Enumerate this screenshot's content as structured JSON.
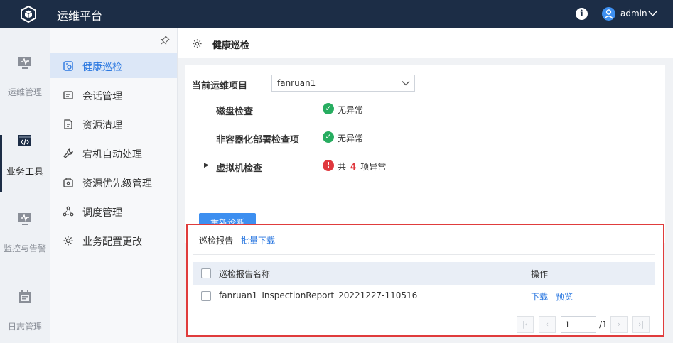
{
  "header": {
    "app_title": "运维平台",
    "user_name": "admin"
  },
  "rail": [
    {
      "label": "运维管理",
      "icon": "monitor-pulse-icon"
    },
    {
      "label": "业务工具",
      "icon": "code-window-icon",
      "active": true
    },
    {
      "label": "监控与告警",
      "icon": "monitor-pulse-icon"
    },
    {
      "label": "日志管理",
      "icon": "calendar-icon"
    }
  ],
  "subnav": [
    {
      "label": "健康巡检",
      "icon": "health-check-icon",
      "active": true
    },
    {
      "label": "会话管理",
      "icon": "session-icon"
    },
    {
      "label": "资源清理",
      "icon": "cleanup-icon"
    },
    {
      "label": "宕机自动处理",
      "icon": "wrench-icon"
    },
    {
      "label": "资源优先级管理",
      "icon": "priority-icon"
    },
    {
      "label": "调度管理",
      "icon": "schedule-icon"
    },
    {
      "label": "业务配置更改",
      "icon": "config-gear-icon"
    }
  ],
  "page": {
    "title": "健康巡检"
  },
  "diagnosis": {
    "project_label": "当前运维项目",
    "project_value": "fanruan1",
    "checks": [
      {
        "name": "磁盘检查",
        "status": "无异常"
      },
      {
        "name": "非容器化部署检查项",
        "status": "无异常"
      },
      {
        "name": "虚拟机检查",
        "status_prefix": "共",
        "status_count": "4",
        "status_suffix": "项异常"
      }
    ],
    "rediagnose_label": "重新诊断"
  },
  "report": {
    "title": "巡检报告",
    "batch_download": "批量下载",
    "col_name": "巡检报告名称",
    "col_action": "操作",
    "rows": [
      {
        "name": "fanruan1_InspectionReport_20221227-110516",
        "download": "下载",
        "preview": "预览"
      }
    ],
    "pager": {
      "page": "1",
      "total": "/1"
    }
  },
  "colors": {
    "topbar": "#1c2d46",
    "accent": "#2a77e0",
    "button": "#3d8ff0",
    "ok": "#27ad60",
    "error": "#e0383e",
    "highlight_border": "#e03c3c"
  }
}
